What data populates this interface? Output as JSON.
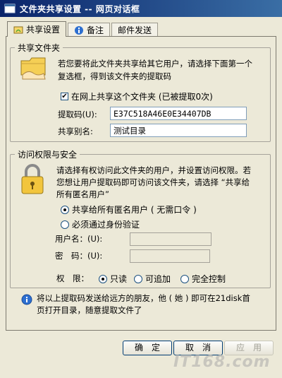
{
  "window": {
    "title": "文件夹共享设置 -- 网页对话框"
  },
  "tabs": [
    {
      "label": "共享设置",
      "active": true
    },
    {
      "label": "备注",
      "active": false
    },
    {
      "label": "邮件发送",
      "active": false
    }
  ],
  "share_group": {
    "legend": "共享文件夹",
    "description_line1": "若您要将此文件夹共享给其它用户，请选择下面第一个",
    "description_line2": "复选框，得到该文件夹的提取码",
    "checkbox_label": "在网上共享这个文件夹 (已被提取0次)",
    "checkbox_checked": true,
    "code_label": "提取码(U):",
    "code_value": "E37C518A46E0E34407DB",
    "alias_label": "共享别名:",
    "alias_value": "测试目录"
  },
  "access_group": {
    "legend": "访问权限与安全",
    "description_line1": "请选择有权访问此文件夹的用户，并设置访问权限。若",
    "description_line2": "您想让用户提取码即可访问该文件夹，请选择 “共享给",
    "description_line3": "所有匿名用户”",
    "radio_anonymous": "共享给所有匿名用户 ( 无需口令 )",
    "radio_auth": "必须通过身份验证",
    "username_label": "用户名：(U):",
    "password_label": "密　码：(U):",
    "username_value": "",
    "password_value": "",
    "permission_label": "权　限：",
    "perm_readonly": "只读",
    "perm_append": "可追加",
    "perm_full": "完全控制"
  },
  "info": {
    "text_line1": "将以上提取码发送给远方的朋友，他 ( 她 ) 即可在21disk首",
    "text_line2": "页打开目录，随意提取文件了"
  },
  "buttons": {
    "ok": "确　定",
    "cancel": "取　消",
    "apply": "应　用"
  },
  "watermark": "IT168.com"
}
